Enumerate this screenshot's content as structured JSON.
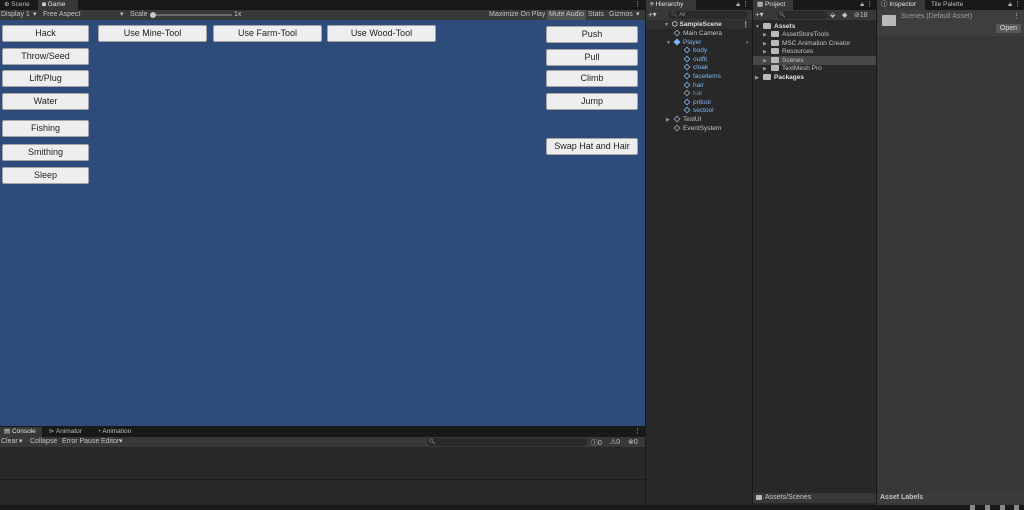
{
  "scene_tabs": {
    "scene": "Scene",
    "game": "Game"
  },
  "game_toolbar": {
    "display": "Display 1",
    "aspect": "Free Aspect",
    "scale_label": "Scale",
    "scale_value": "1x",
    "maximize": "Maximize On Play",
    "mute": "Mute Audio",
    "stats": "Stats",
    "gizmos": "Gizmos"
  },
  "game_buttons_left_col": [
    "Hack",
    "Throw/Seed",
    "Lift/Plug",
    "Water",
    "Fishing",
    "Smithing",
    "Sleep"
  ],
  "game_buttons_tools": [
    "Use Mine-Tool",
    "Use Farm-Tool",
    "Use Wood-Tool"
  ],
  "game_buttons_right_col": [
    "Push",
    "Pull",
    "Climb",
    "Jump",
    "Swap Hat and Hair"
  ],
  "bottom_tabs": {
    "console": "Console",
    "animator": "Animator",
    "animation": "Animation"
  },
  "console_toolbar": {
    "clear": "Clear",
    "collapse": "Collapse",
    "error_pause": "Error Pause",
    "editor": "Editor",
    "count_info": "0",
    "count_warn": "0",
    "count_err": "0"
  },
  "hierarchy": {
    "tab": "Hierarchy",
    "search_placeholder": "All",
    "scene": "SampleScene",
    "items": [
      {
        "label": "Main Camera",
        "indent": 1,
        "style": "normal"
      },
      {
        "label": "Player",
        "indent": 1,
        "style": "blue"
      },
      {
        "label": "body",
        "indent": 2,
        "style": "blue"
      },
      {
        "label": "outfit",
        "indent": 2,
        "style": "blue"
      },
      {
        "label": "cloak",
        "indent": 2,
        "style": "blue"
      },
      {
        "label": "faceitems",
        "indent": 2,
        "style": "blue"
      },
      {
        "label": "hair",
        "indent": 2,
        "style": "blue"
      },
      {
        "label": "hat",
        "indent": 2,
        "style": "dim"
      },
      {
        "label": "pritool",
        "indent": 2,
        "style": "blue"
      },
      {
        "label": "sectool",
        "indent": 2,
        "style": "blue"
      },
      {
        "label": "TestUI",
        "indent": 1,
        "style": "normal"
      },
      {
        "label": "EventSystem",
        "indent": 1,
        "style": "normal"
      }
    ]
  },
  "project": {
    "tab": "Project",
    "badge": "18",
    "assets": "Assets",
    "folders": [
      "AssetStoreTools",
      "MSC Animation Creator",
      "Resources",
      "Scenes",
      "TextMesh Pro"
    ],
    "packages": "Packages",
    "footer": "Assets/Scenes"
  },
  "inspector": {
    "tab": "Inspector",
    "tab2": "Tile Palette",
    "title": "Scenes (Default Asset)",
    "open": "Open",
    "footer": "Asset Labels"
  }
}
